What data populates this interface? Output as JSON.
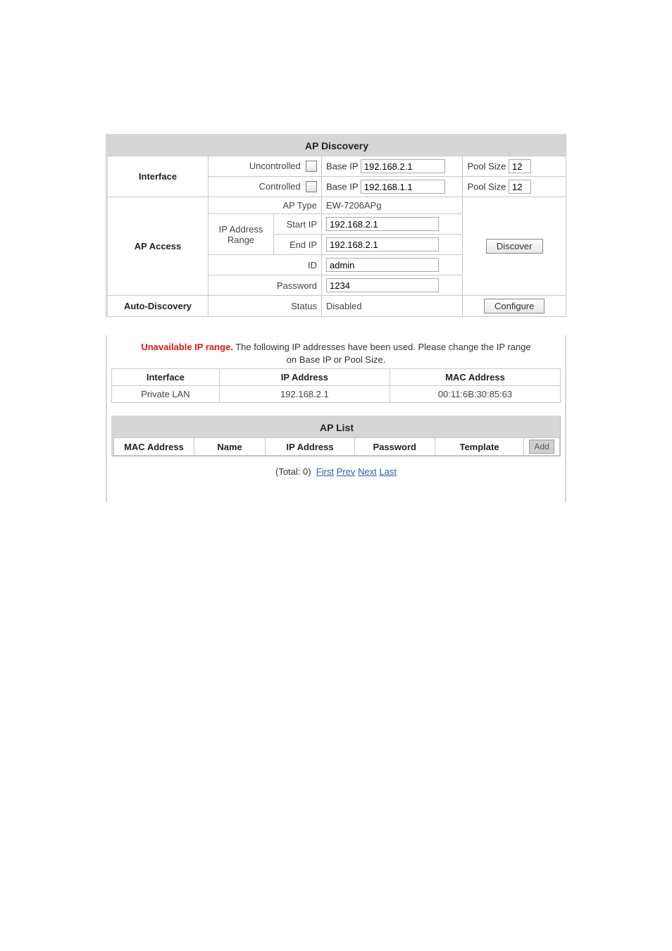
{
  "discovery": {
    "title": "AP Discovery",
    "interface_label": "Interface",
    "uncontrolled": {
      "label": "Uncontrolled",
      "base_ip_label": "Base IP",
      "base_ip": "192.168.2.1",
      "pool_label": "Pool Size",
      "pool": "12"
    },
    "controlled": {
      "label": "Controlled",
      "base_ip_label": "Base IP",
      "base_ip": "192.168.1.1",
      "pool_label": "Pool Size",
      "pool": "12"
    },
    "ap_access_label": "AP Access",
    "ap_type_label": "AP Type",
    "ap_type": "EW-7206APg",
    "ip_range_label": "IP Address Range",
    "start_ip_label": "Start IP",
    "start_ip": "192.168.2.1",
    "end_ip_label": "End IP",
    "end_ip": "192.168.2.1",
    "id_label": "ID",
    "id": "admin",
    "password_label": "Password",
    "password": "1234",
    "discover_btn": "Discover",
    "auto_label": "Auto-Discovery",
    "status_label": "Status",
    "status_value": "Disabled",
    "configure_btn": "Configure"
  },
  "warning": {
    "title": "Unavailable IP range.",
    "text": " The following IP addresses have been used. Please change the IP range on Base IP or Pool Size."
  },
  "used_table": {
    "headers": {
      "interface": "Interface",
      "ip": "IP Address",
      "mac": "MAC Address"
    },
    "rows": [
      {
        "interface": "Private LAN",
        "ip": "192.168.2.1",
        "mac": "00:11:6B:30:85:63"
      }
    ]
  },
  "aplist": {
    "title": "AP List",
    "headers": {
      "mac": "MAC Address",
      "name": "Name",
      "ip": "IP Address",
      "password": "Password",
      "template": "Template",
      "add": "Add"
    },
    "pager": {
      "total_label": "(Total: 0)",
      "first": "First",
      "prev": "Prev",
      "next": "Next",
      "last": "Last"
    }
  }
}
